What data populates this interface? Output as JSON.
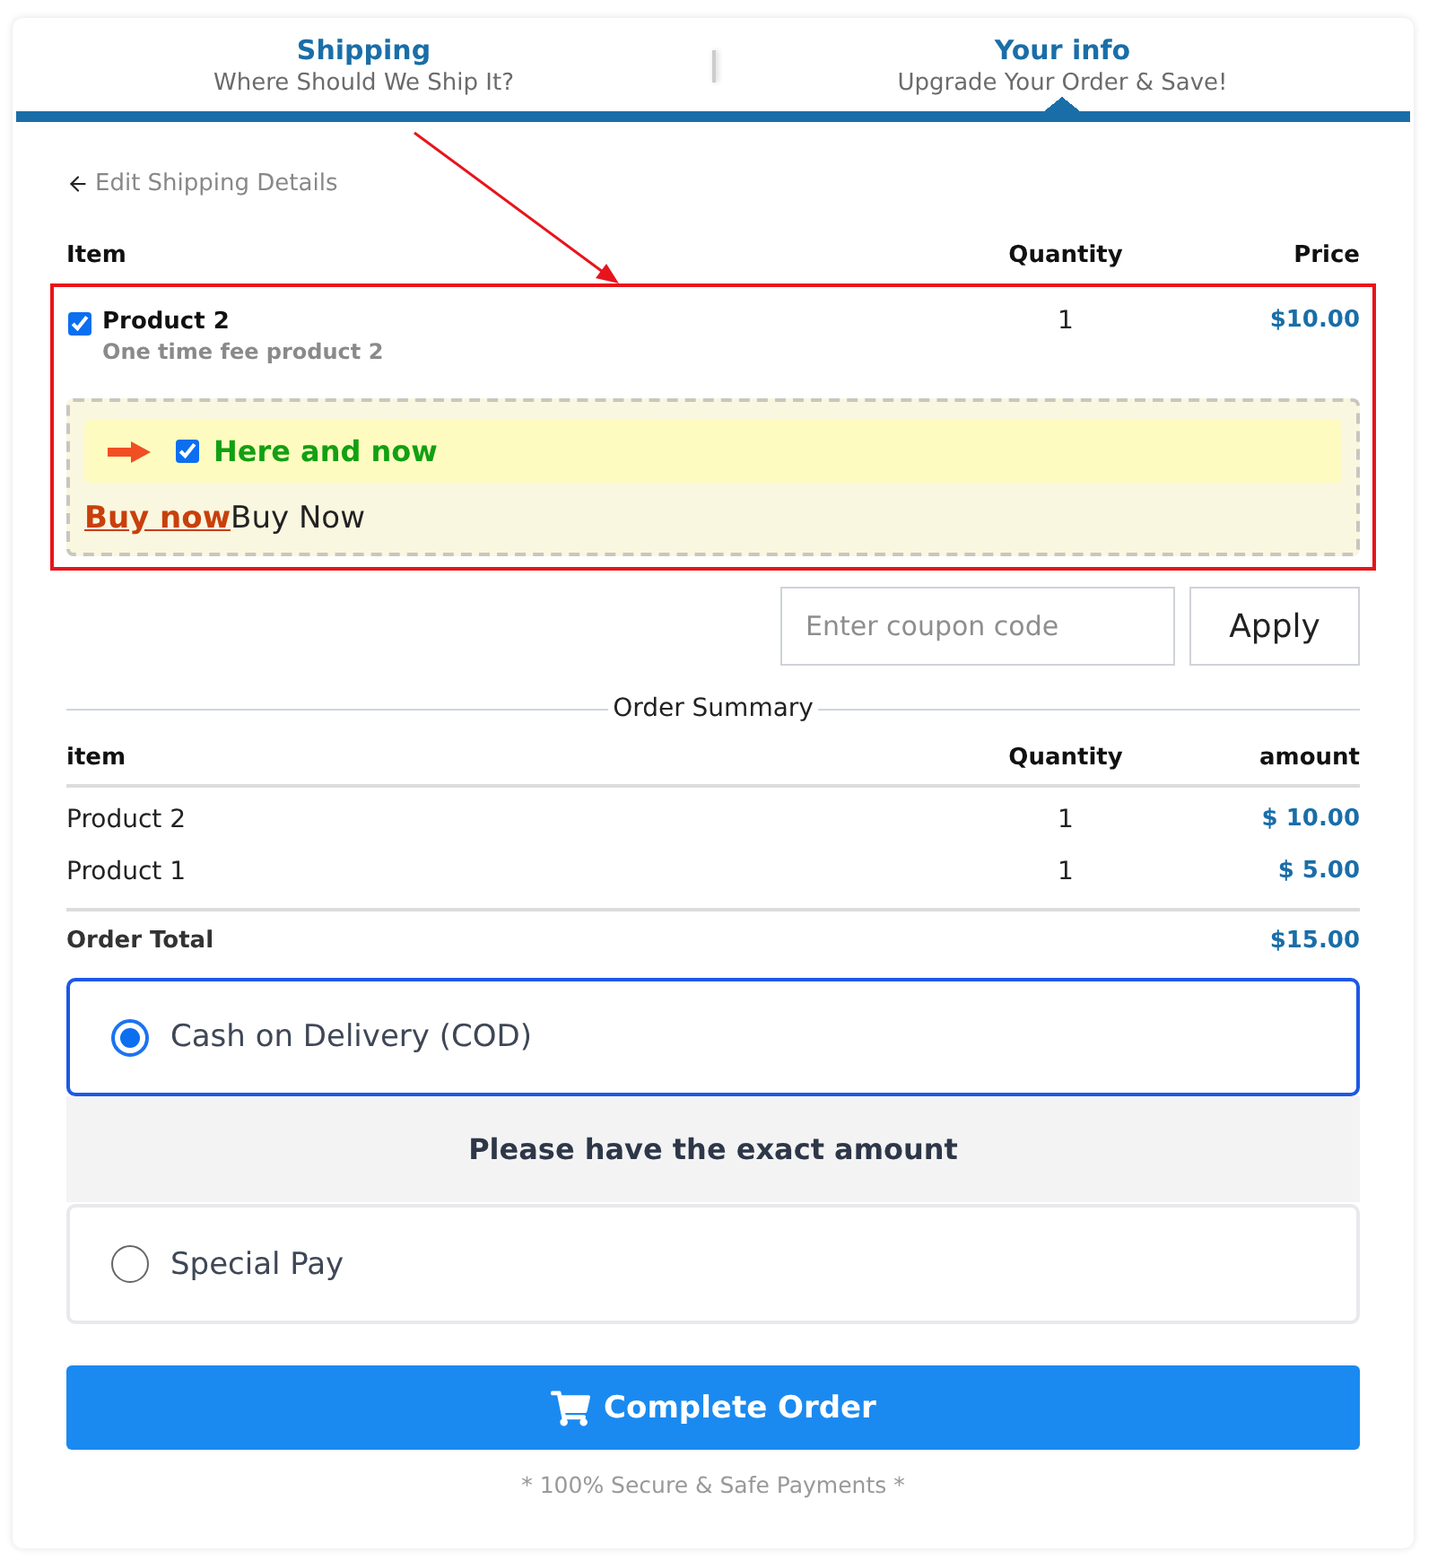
{
  "steps": [
    {
      "title": "Shipping",
      "subtitle": "Where Should We Ship It?",
      "selected": false
    },
    {
      "title": "Your info",
      "subtitle": "Upgrade Your Order & Save!",
      "selected": true
    }
  ],
  "back_link": {
    "label": "Edit Shipping Details"
  },
  "items_table": {
    "columns": [
      "Item",
      "Quantity",
      "Price"
    ],
    "rows": [
      {
        "name": "Product 2",
        "description": "One time fee product 2",
        "quantity": "1",
        "price": "$10.00",
        "checked": true
      }
    ]
  },
  "upsell": {
    "checked": true,
    "headline": "Here and now",
    "link": "Buy now",
    "text": "Buy Now"
  },
  "coupon": {
    "placeholder": "Enter coupon code",
    "button": "Apply"
  },
  "order_summary": {
    "title": "Order Summary",
    "columns": [
      "item",
      "Quantity",
      "amount"
    ],
    "rows": [
      {
        "item": "Product 2",
        "quantity": "1",
        "amount": "$ 10.00"
      },
      {
        "item": "Product 1",
        "quantity": "1",
        "amount": "$ 5.00"
      }
    ],
    "total": {
      "label": "Order Total",
      "amount": "$15.00"
    }
  },
  "payment_methods": [
    {
      "label": "Cash on Delivery (COD)",
      "selected": true,
      "note": "Please have the exact amount"
    },
    {
      "label": "Special Pay",
      "selected": false
    }
  ],
  "submit": {
    "label": "Complete Order"
  },
  "footer_note": "* 100% Secure & Safe Payments *"
}
